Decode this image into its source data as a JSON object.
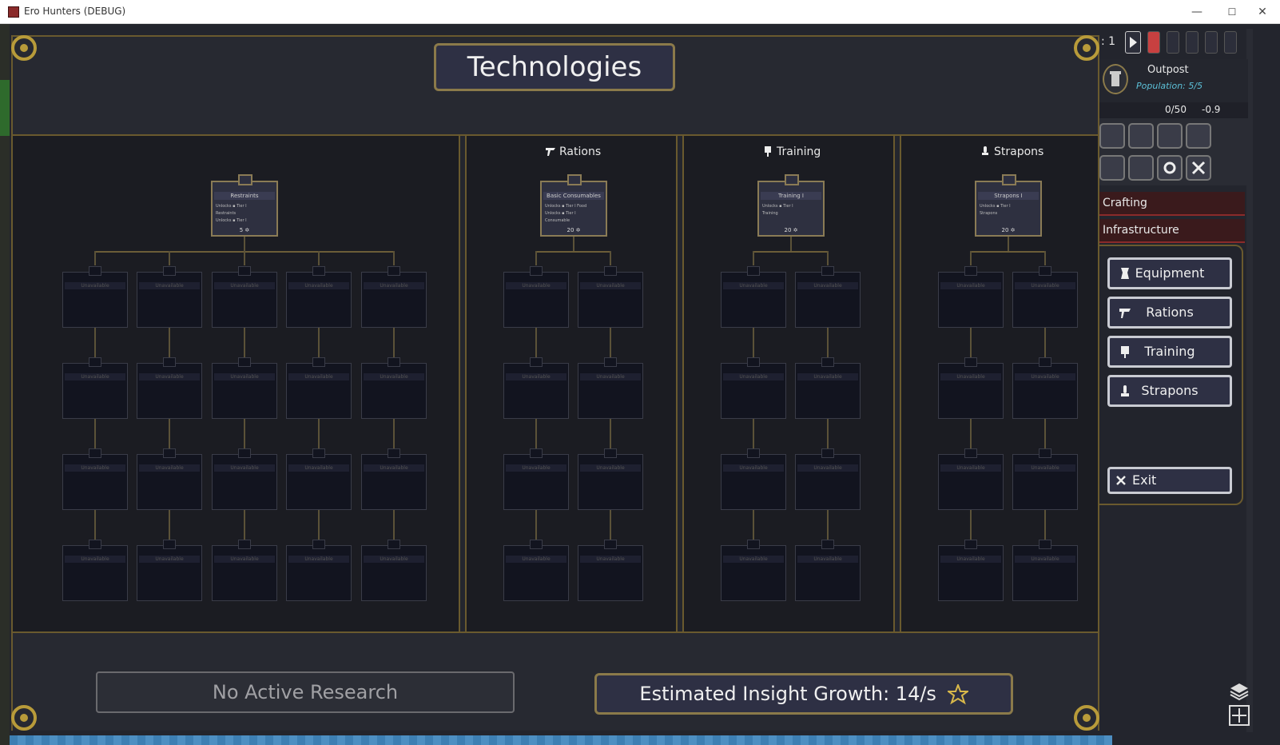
{
  "window": {
    "title": "Ero Hunters (DEBUG)",
    "minimize": "—",
    "maximize": "☐",
    "close": "✕"
  },
  "panel": {
    "title": "Technologies"
  },
  "columns": [
    {
      "name": "",
      "root": {
        "title": "Restraints",
        "lines": [
          "Unlocks ▪ Tier I",
          "Restraints",
          "Unlocks ▪ Tier I"
        ],
        "cost": "5"
      }
    },
    {
      "name": "Rations",
      "root": {
        "title": "Basic Consumables",
        "lines": [
          "Unlocks ▪ Tier I Food",
          "Unlocks ▪ Tier I",
          "Consumable"
        ],
        "cost": "20"
      }
    },
    {
      "name": "Training",
      "root": {
        "title": "Training I",
        "lines": [
          "Unlocks ▪ Tier I",
          "Training"
        ],
        "cost": "20"
      }
    },
    {
      "name": "Strapons",
      "root": {
        "title": "Strapons I",
        "lines": [
          "Unlocks ▪ Tier I",
          "Strapons"
        ],
        "cost": "20"
      }
    }
  ],
  "locked_label": "Unavailable",
  "footer": {
    "no_research": "No Active Research",
    "insight": "Estimated Insight Growth: 14/s"
  },
  "hud": {
    "day_fragment": ": 1",
    "outpost_name": "Outpost",
    "population": "Population: 5/5",
    "storage": "0/50",
    "rate": "-0.9"
  },
  "tabs": {
    "crafting": "Crafting",
    "infrastructure": "Infrastructure"
  },
  "menu": {
    "items": [
      "Equipment",
      "Rations",
      "Training",
      "Strapons"
    ],
    "exit": "Exit"
  },
  "colors": {
    "gold_border": "#8b7a4a",
    "panel_bg": "#24262e",
    "accent_cyan": "#5cc0d8",
    "tab_red": "#8a2a2a"
  }
}
